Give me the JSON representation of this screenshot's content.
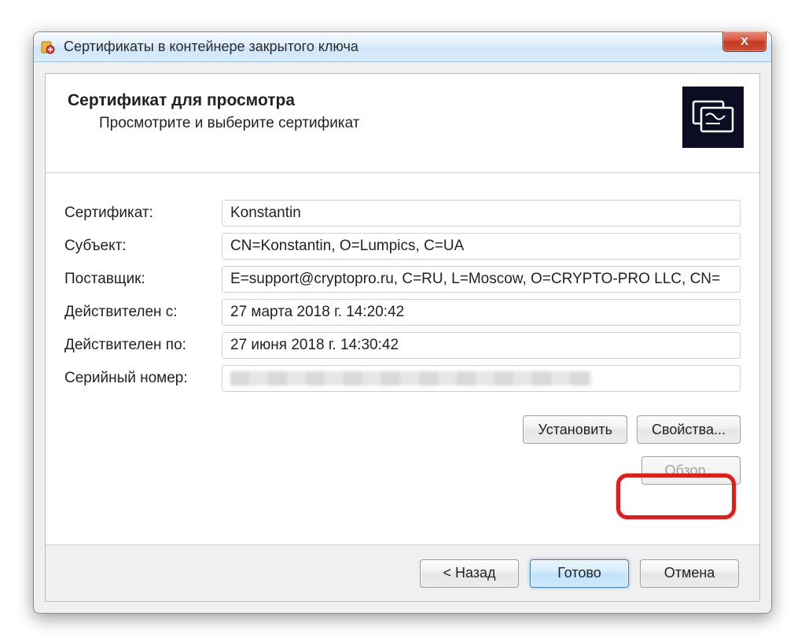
{
  "window": {
    "title": "Сертификаты в контейнере закрытого ключа"
  },
  "header": {
    "title": "Сертификат для просмотра",
    "subtitle": "Просмотрите и выберите сертификат"
  },
  "labels": {
    "certificate": "Сертификат:",
    "subject": "Субъект:",
    "issuer": "Поставщик:",
    "valid_from": "Действителен с:",
    "valid_to": "Действителен по:",
    "serial": "Серийный номер:"
  },
  "values": {
    "certificate": "Konstantin",
    "subject": "CN=Konstantin, O=Lumpics, C=UA",
    "issuer": "E=support@cryptopro.ru, C=RU, L=Moscow, O=CRYPTO-PRO LLC, CN=",
    "valid_from": "27 марта 2018 г. 14:20:42",
    "valid_to": "27 июня 2018 г. 14:30:42",
    "serial": ""
  },
  "buttons": {
    "install": "Установить",
    "properties": "Свойства...",
    "browse": "Обзор...",
    "back": "< Назад",
    "finish": "Готово",
    "cancel": "Отмена"
  }
}
